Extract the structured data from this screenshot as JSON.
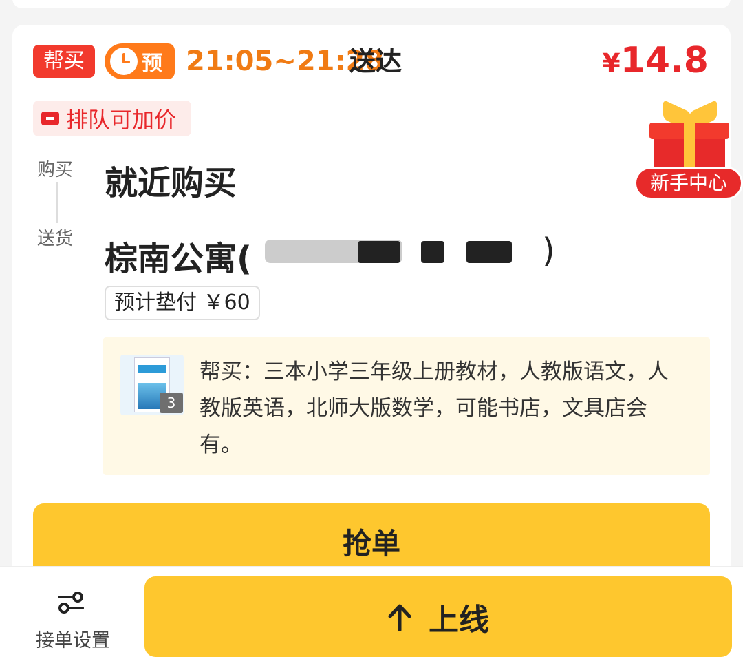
{
  "order": {
    "tag_bangmai": "帮买",
    "tag_yu": "预",
    "time_range": "21:05~21:28",
    "time_suffix": "送达",
    "price_symbol": "¥",
    "price_value": "14.8",
    "queue_tag": "排队可加价",
    "side_label_buy": "购买",
    "side_label_deliver": "送货",
    "buy_title": "就近购买",
    "address_title": "棕南公寓(",
    "address_close": ")",
    "advance_payment": "预计垫付 ￥60",
    "note": {
      "image_count": "3",
      "text": "帮买：三本小学三年级上册教材，人教版语文，人教版英语，北师大版数学，可能书店，文具店会有。"
    },
    "grab_button": "抢单"
  },
  "newbie_center": {
    "label": "新手中心"
  },
  "bottom_bar": {
    "settings_label": "接单设置",
    "online_button": "上线"
  },
  "colors": {
    "accent_red": "#f23a2d",
    "accent_orange": "#ff7a1a",
    "time_orange": "#f07b14",
    "price_red": "#e8272b",
    "button_yellow": "#fec72e",
    "note_bg": "#fff9e6"
  },
  "icons": {
    "clock": "clock-icon",
    "ticket": "ticket-icon",
    "gift": "gift-icon",
    "settings": "toggle-settings-icon",
    "up_arrow": "up-arrow-icon"
  }
}
